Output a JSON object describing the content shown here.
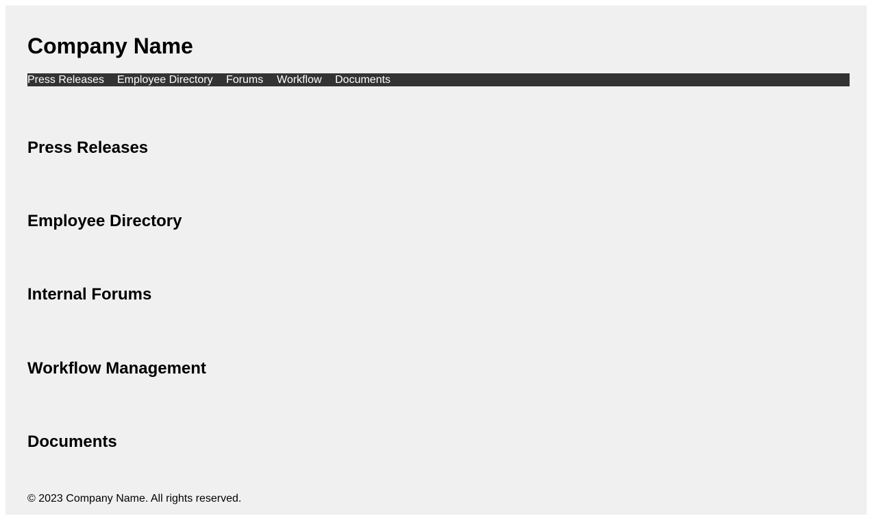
{
  "header": {
    "company_name": "Company Name"
  },
  "nav": {
    "items": [
      {
        "label": "Press Releases"
      },
      {
        "label": "Employee Directory"
      },
      {
        "label": "Forums"
      },
      {
        "label": "Workflow"
      },
      {
        "label": "Documents"
      }
    ]
  },
  "sections": [
    {
      "title": "Press Releases"
    },
    {
      "title": "Employee Directory"
    },
    {
      "title": "Internal Forums"
    },
    {
      "title": "Workflow Management"
    },
    {
      "title": "Documents"
    }
  ],
  "footer": {
    "copyright": "© 2023 Company Name. All rights reserved."
  },
  "colors": {
    "page_background": "#f0f0f0",
    "nav_background": "#333333",
    "nav_text": "#ffffff"
  }
}
